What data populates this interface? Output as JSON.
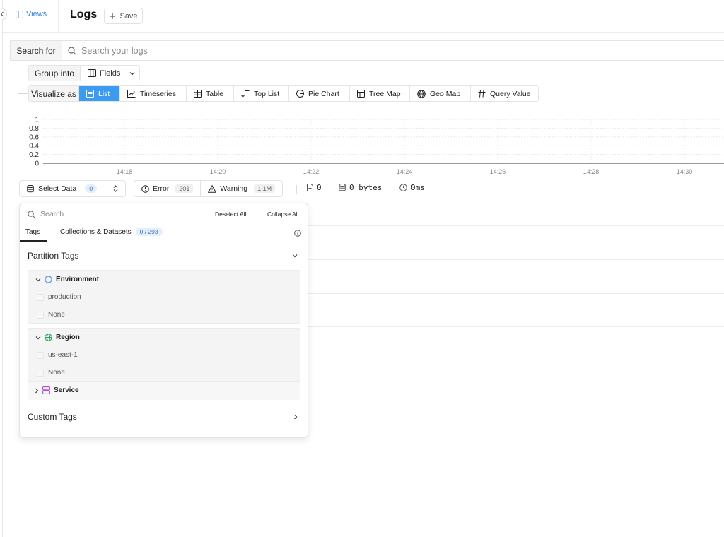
{
  "header": {
    "views_label": "Views",
    "title": "Logs",
    "save_label": "Save"
  },
  "search": {
    "label": "Search for",
    "placeholder": "Search your logs"
  },
  "group_into": {
    "label": "Group into",
    "selected": "Fields"
  },
  "visualize": {
    "label": "Visualize as",
    "options": [
      {
        "label": "List",
        "icon": "list-icon",
        "active": true
      },
      {
        "label": "Timeseries",
        "icon": "line-chart-icon"
      },
      {
        "label": "Table",
        "icon": "table-icon"
      },
      {
        "label": "Top List",
        "icon": "sort-desc-icon"
      },
      {
        "label": "Pie Chart",
        "icon": "pie-chart-icon"
      },
      {
        "label": "Tree Map",
        "icon": "tree-map-icon"
      },
      {
        "label": "Geo Map",
        "icon": "globe-icon"
      },
      {
        "label": "Query Value",
        "icon": "hash-icon"
      }
    ],
    "active_color": "#3b9bf0"
  },
  "chart_data": {
    "type": "bar",
    "title": "",
    "xlabel": "",
    "ylabel": "",
    "y_ticks": [
      "1",
      "0.8",
      "0.6",
      "0.4",
      "0.2",
      "0"
    ],
    "x_ticks": [
      "14:18",
      "14:20",
      "14:22",
      "14:24",
      "14:26",
      "14:28",
      "14:30"
    ],
    "ylim": [
      0,
      1
    ],
    "series": [],
    "grid": true
  },
  "toolbar": {
    "select_data_label": "Select Data",
    "select_data_count": "0",
    "error_label": "Error",
    "error_count": "201",
    "warning_label": "Warning",
    "warning_count": "1.1M",
    "records": "0",
    "bytes": "0 bytes",
    "duration": "0ms"
  },
  "panel": {
    "search_placeholder": "Search",
    "deselect_all": "Deselect All",
    "collapse_all": "Collapse All",
    "tabs": [
      {
        "label": "Tags",
        "active": true
      },
      {
        "label": "Collections & Datasets",
        "badge": "0 / 293"
      }
    ],
    "partition_tags_title": "Partition Tags",
    "groups": [
      {
        "name": "Environment",
        "icon": "circle-icon",
        "icon_color": "#3b82f6",
        "expanded": true,
        "options": [
          "production",
          "None"
        ]
      },
      {
        "name": "Region",
        "icon": "globe-icon",
        "icon_color": "#22a35a",
        "expanded": true,
        "options": [
          "us-east-1",
          "None"
        ]
      },
      {
        "name": "Service",
        "icon": "server-icon",
        "icon_color": "#b049d6",
        "expanded": false,
        "options": []
      }
    ],
    "custom_tags_title": "Custom Tags"
  }
}
